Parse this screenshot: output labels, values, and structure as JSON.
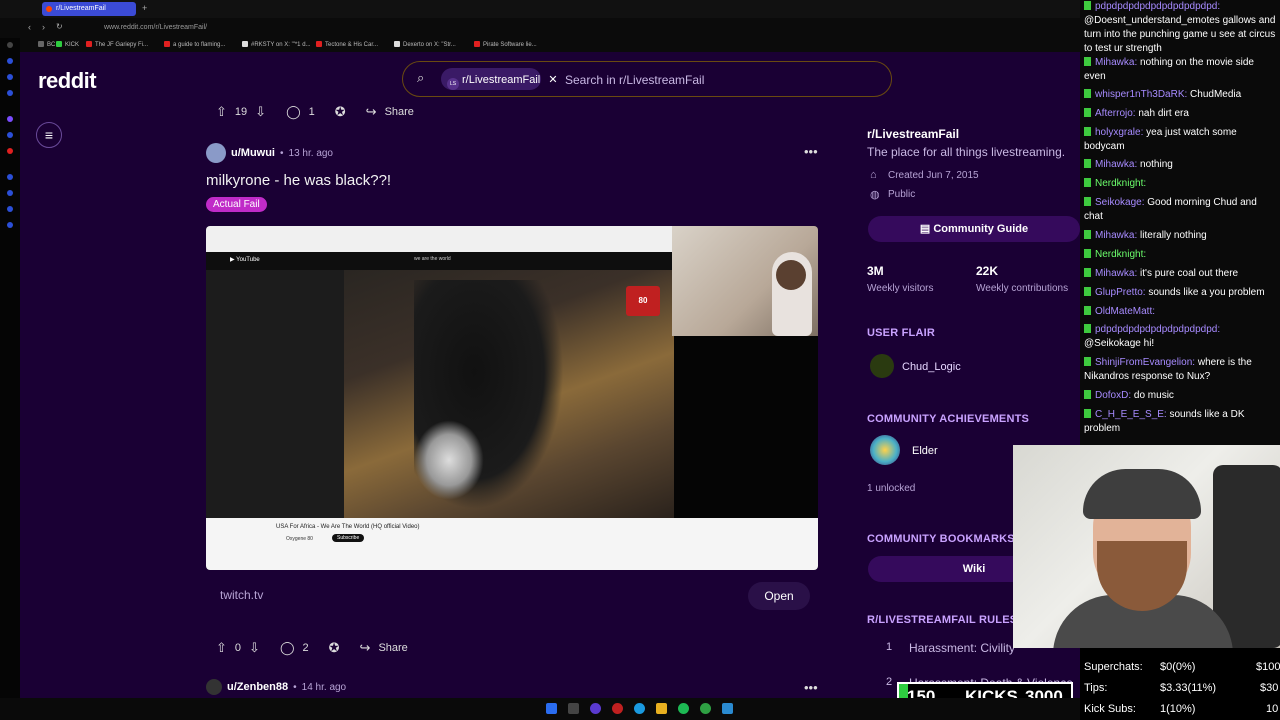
{
  "browser": {
    "tab_title": "r/LivestreamFail",
    "new_tab": "+",
    "url": "www.reddit.com/r/LivestreamFail/",
    "bookmarks": [
      "BC",
      "KICK",
      "The JF Gariepy Fi...",
      "a guide to flaming...",
      "#RKSTY on X: \"'*1 d...",
      "Tectone & His Car...",
      "Dexerto on X: \"Str...",
      "Pirate Software lie..."
    ]
  },
  "reddit": {
    "logo": "reddit",
    "search": {
      "chip": "r/LivestreamFail",
      "chip_icon": "LS",
      "placeholder": "Search in r/LivestreamFail"
    },
    "prev_post_bar": {
      "votes": "19",
      "comments": "1",
      "share": "Share"
    },
    "post": {
      "author": "u/Muwui",
      "age": "13 hr. ago",
      "title": "milkyrone - he was black??!",
      "flair": "Actual Fail",
      "media": {
        "inner_search": "we are the world",
        "video_title": "USA For Africa - We Are The World (HQ official Video)",
        "channel": "Oxygene 80",
        "subscribe": "Subscribe",
        "badge": "80"
      },
      "domain": "twitch.tv",
      "open": "Open",
      "votes": "0",
      "comments": "2",
      "share": "Share"
    },
    "next_post": {
      "author": "u/Zenben88",
      "age": "14 hr. ago"
    },
    "sidebar": {
      "name": "r/LivestreamFail",
      "description": "The place for all things livestreaming.",
      "created": "Created Jun 7, 2015",
      "visibility": "Public",
      "guide_button": "Community Guide",
      "visitors_value": "3M",
      "visitors_label": "Weekly visitors",
      "contrib_value": "22K",
      "contrib_label": "Weekly contributions",
      "flair_heading": "USER FLAIR",
      "flair_name": "Chud_Logic",
      "achievements_heading": "COMMUNITY ACHIEVEMENTS",
      "achievement_name": "Elder",
      "unlocked": "1 unlocked",
      "bookmarks_heading": "COMMUNITY BOOKMARKS",
      "wiki": "Wiki",
      "rules_heading": "R/LIVESTREAMFAIL RULES",
      "rule1_num": "1",
      "rule1": "Harassment: Civility",
      "rule2_num": "2",
      "rule2": "Harassment: Death & Violence"
    }
  },
  "chat": {
    "messages": [
      {
        "user": "pdpdpdpdpdpdpdpdpdpdpd:",
        "text": "@Doesnt_understand_emotes gallows and turn into the punching game u see at circus to test ur strength",
        "color": "#a78bff"
      },
      {
        "user": "Mihawka:",
        "text": "nothing on the movie side even",
        "color": "#a78bff"
      },
      {
        "user": "whisper1nTh3DaRK:",
        "text": "ChudMedia",
        "color": "#a78bff"
      },
      {
        "user": "Afterrojo:",
        "text": "nah dirt era",
        "color": "#a78bff"
      },
      {
        "user": "holyxgrale:",
        "text": "yea just watch some bodycam",
        "color": "#a78bff"
      },
      {
        "user": "Mihawka:",
        "text": "nothing",
        "color": "#a78bff"
      },
      {
        "user": "Nerdknight:",
        "text": "",
        "color": "#6cff6c"
      },
      {
        "user": "Seikokage:",
        "text": "Good morning Chud and chat",
        "color": "#a78bff"
      },
      {
        "user": "Mihawka:",
        "text": "literally nothing",
        "color": "#a78bff"
      },
      {
        "user": "Nerdknight:",
        "text": "",
        "color": "#6cff6c"
      },
      {
        "user": "Mihawka:",
        "text": "it's pure coal out there",
        "color": "#a78bff"
      },
      {
        "user": "GlupPretto:",
        "text": "sounds like a you problem",
        "color": "#a78bff"
      },
      {
        "user": "OldMateMatt:",
        "text": "",
        "color": "#a78bff"
      },
      {
        "user": "pdpdpdpdpdpdpdpdpdpdpd:",
        "text": "@Seikokage hi!",
        "color": "#a78bff"
      },
      {
        "user": "ShinjiFromEvangelion:",
        "text": "where is the Nikandros response to Nux?",
        "color": "#a78bff"
      },
      {
        "user": "DofoxD:",
        "text": "do music",
        "color": "#a78bff"
      },
      {
        "user": "C_H_E_E_S_E:",
        "text": "sounds like a DK problem",
        "color": "#a78bff"
      }
    ]
  },
  "stats": {
    "superchats_label": "Superchats:",
    "superchats_value": "$0(0%)",
    "superchats_goal": "$100",
    "tips_label": "Tips:",
    "tips_value": "$3.33(11%)",
    "tips_goal": "$30",
    "kicksubs_label": "Kick Subs:",
    "kicksubs_value": "1(10%)",
    "kicksubs_goal": "10"
  },
  "kicks": {
    "current": "150",
    "label": "KICKS",
    "goal": "3000",
    "progress": 0.05
  },
  "colors": {
    "reddit_bg": "#1a0034",
    "accent": "#c02bc8",
    "kick_green": "#2ecc40"
  },
  "icons": [
    "menu-icon",
    "search-icon",
    "upvote-icon",
    "downvote-icon",
    "comment-icon",
    "award-icon",
    "share-icon",
    "more-icon",
    "cake-icon",
    "globe-icon",
    "book-icon"
  ]
}
